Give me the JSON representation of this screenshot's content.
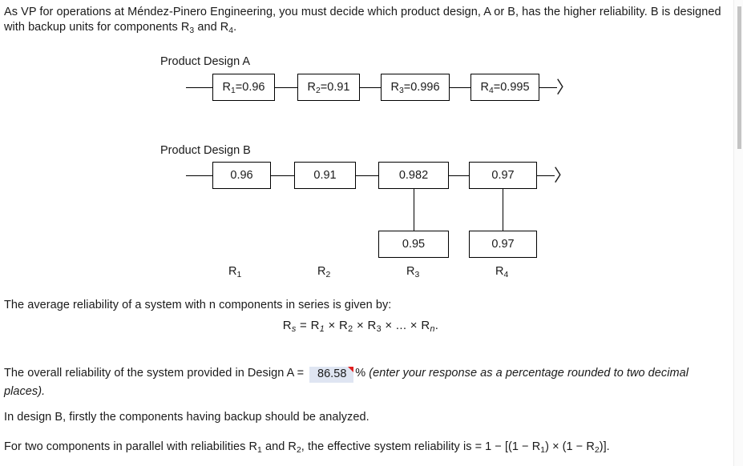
{
  "intro": {
    "text_before_sub3": "As VP for operations at Méndez-Pinero Engineering, you must decide which product design, A or B, has the higher reliability. B is designed with backup units for components R",
    "sub3": "3",
    "text_mid": " and R",
    "sub4": "4",
    "text_end": "."
  },
  "design_a": {
    "title": "Product Design A",
    "boxes": [
      {
        "label": "R",
        "sub": "1",
        "eq": "=0.96"
      },
      {
        "label": "R",
        "sub": "2",
        "eq": "=0.91"
      },
      {
        "label": "R",
        "sub": "3",
        "eq": "=0.996"
      },
      {
        "label": "R",
        "sub": "4",
        "eq": "=0.995"
      }
    ],
    "end_marker": "〉"
  },
  "design_b": {
    "title": "Product Design B",
    "primary_boxes": [
      "0.96",
      "0.91",
      "0.982",
      "0.97"
    ],
    "backup_boxes": [
      "0.95",
      "0.97"
    ],
    "component_labels": [
      {
        "label": "R",
        "sub": "1"
      },
      {
        "label": "R",
        "sub": "2"
      },
      {
        "label": "R",
        "sub": "3"
      },
      {
        "label": "R",
        "sub": "4"
      }
    ],
    "end_marker": "〉"
  },
  "series_text": "The average reliability of a system with n components in series is given by:",
  "formula": {
    "lhs": "R",
    "lhs_sub": "s",
    "eq": " = ",
    "r1": "R",
    "r1_sub": "1",
    "times1": " × ",
    "r2": "R",
    "r2_sub": "2",
    "times2": " × ",
    "r3": "R",
    "r3_sub": "3",
    "times3": " × ... × ",
    "rn": "R",
    "rn_sub": "n",
    "period": "."
  },
  "answer": {
    "prefix": "The overall reliability of the system provided in Design A = ",
    "value": "86.58",
    "percent": "%",
    "hint": "(enter your response as a percentage rounded to two decimal places)",
    "hint_period": "."
  },
  "design_b_note": "In design B, firstly the components having backup should be analyzed.",
  "parallel": {
    "prefix": "For two components in parallel with reliabilities R",
    "sub1": "1",
    "mid": " and R",
    "sub2": "2",
    "suffix": ", the effective system reliability is = 1 − [(1 − R",
    "sub3": "1",
    "suffix2": ") × (1 − R",
    "sub4": "2",
    "suffix3": ")]."
  },
  "colors": {
    "text": "#1a1a1a",
    "answer_bg": "#dfe5f2",
    "flag_red": "#e02020",
    "line": "#000000",
    "scrollbar_thumb": "#c4c4c4"
  }
}
